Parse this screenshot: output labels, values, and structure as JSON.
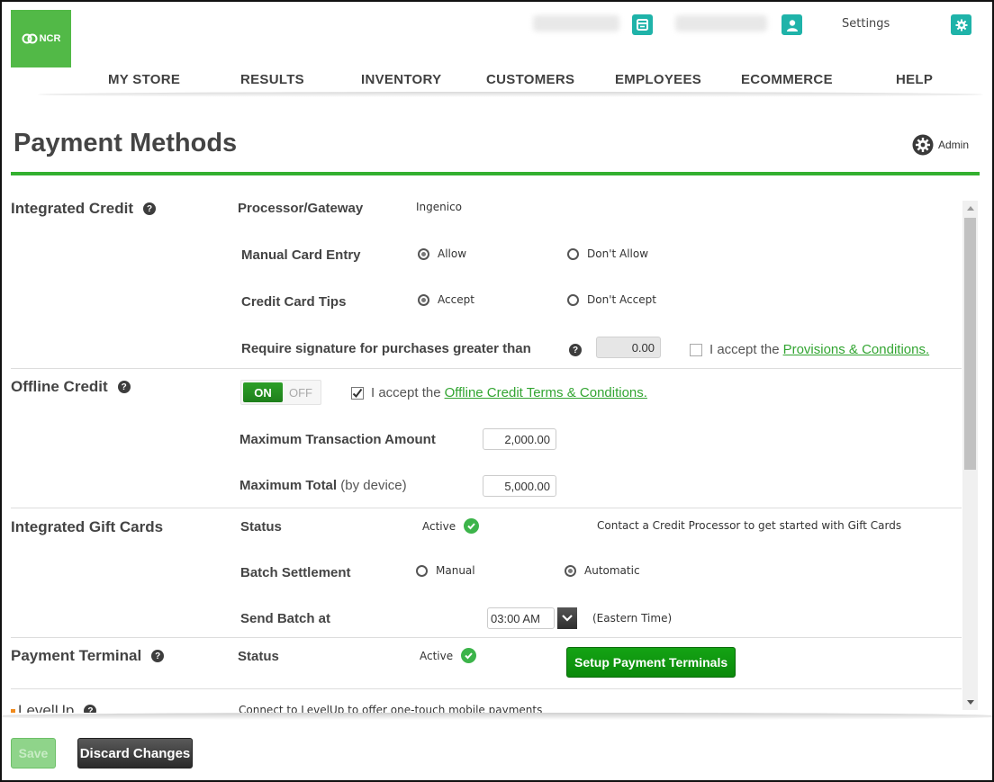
{
  "brand": {
    "logo_text": "NCR",
    "accent": "#52b947",
    "teal": "#1fb3a9",
    "link": "#33a532"
  },
  "topbar": {
    "store_name_blurred": "",
    "user_name_blurred": "",
    "settings_label": "Settings"
  },
  "nav": {
    "items": [
      "MY STORE",
      "RESULTS",
      "INVENTORY",
      "CUSTOMERS",
      "EMPLOYEES",
      "ECOMMERCE",
      "HELP"
    ]
  },
  "page": {
    "title": "Payment Methods",
    "admin_label": "Admin"
  },
  "integrated_credit": {
    "title": "Integrated Credit",
    "processor_label": "Processor/Gateway",
    "processor_value": "Ingenico",
    "manual_entry_label": "Manual Card Entry",
    "manual_entry_options": [
      "Allow",
      "Don't Allow"
    ],
    "manual_entry_selected": "Allow",
    "tips_label": "Credit Card Tips",
    "tips_options": [
      "Accept",
      "Don't Accept"
    ],
    "tips_selected": "Accept",
    "signature_label": "Require signature for purchases greater than",
    "signature_value": "0.00",
    "accept_prefix": "I accept the",
    "accept_link": "Provisions & Conditions.",
    "accept_checked": false
  },
  "offline_credit": {
    "title": "Offline Credit",
    "toggle_on": "ON",
    "toggle_off": "OFF",
    "enabled": true,
    "accept_prefix": "I accept the",
    "accept_link": "Offline Credit Terms & Conditions.",
    "accept_checked": true,
    "max_txn_label": "Maximum Transaction Amount",
    "max_txn_value": "2,000.00",
    "max_total_label": "Maximum Total",
    "max_total_sub": "(by device)",
    "max_total_value": "5,000.00"
  },
  "gift_cards": {
    "title": "Integrated Gift Cards",
    "status_label": "Status",
    "status_value": "Active",
    "contact_text": "Contact a Credit Processor to get started with Gift Cards",
    "batch_label": "Batch Settlement",
    "batch_options": [
      "Manual",
      "Automatic"
    ],
    "batch_selected": "Automatic",
    "send_label": "Send Batch at",
    "send_time": "03:00 AM",
    "timezone": "(Eastern Time)"
  },
  "payment_terminal": {
    "title": "Payment Terminal",
    "status_label": "Status",
    "status_value": "Active",
    "setup_button": "Setup Payment Terminals"
  },
  "levelup": {
    "title": "LevelUp",
    "description": "Connect to LevelUp to offer one-touch mobile payments"
  },
  "footer": {
    "save_label": "Save",
    "discard_label": "Discard Changes"
  }
}
